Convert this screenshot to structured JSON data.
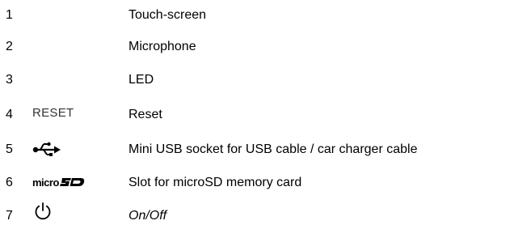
{
  "rows": [
    {
      "number": "1",
      "symbol": "",
      "description": "Touch-screen"
    },
    {
      "number": "2",
      "symbol": "",
      "description": "Microphone"
    },
    {
      "number": "3",
      "symbol": "",
      "description": "LED"
    },
    {
      "number": "4",
      "symbol": "RESET",
      "description": "Reset"
    },
    {
      "number": "5",
      "symbol": "usb-icon",
      "description": "Mini USB socket for USB cable / car charger cable"
    },
    {
      "number": "6",
      "symbol": "microsd-logo",
      "micro_text": "micro",
      "description": "Slot for microSD memory card"
    },
    {
      "number": "7",
      "symbol": "power-icon",
      "description": "On/Off"
    }
  ]
}
